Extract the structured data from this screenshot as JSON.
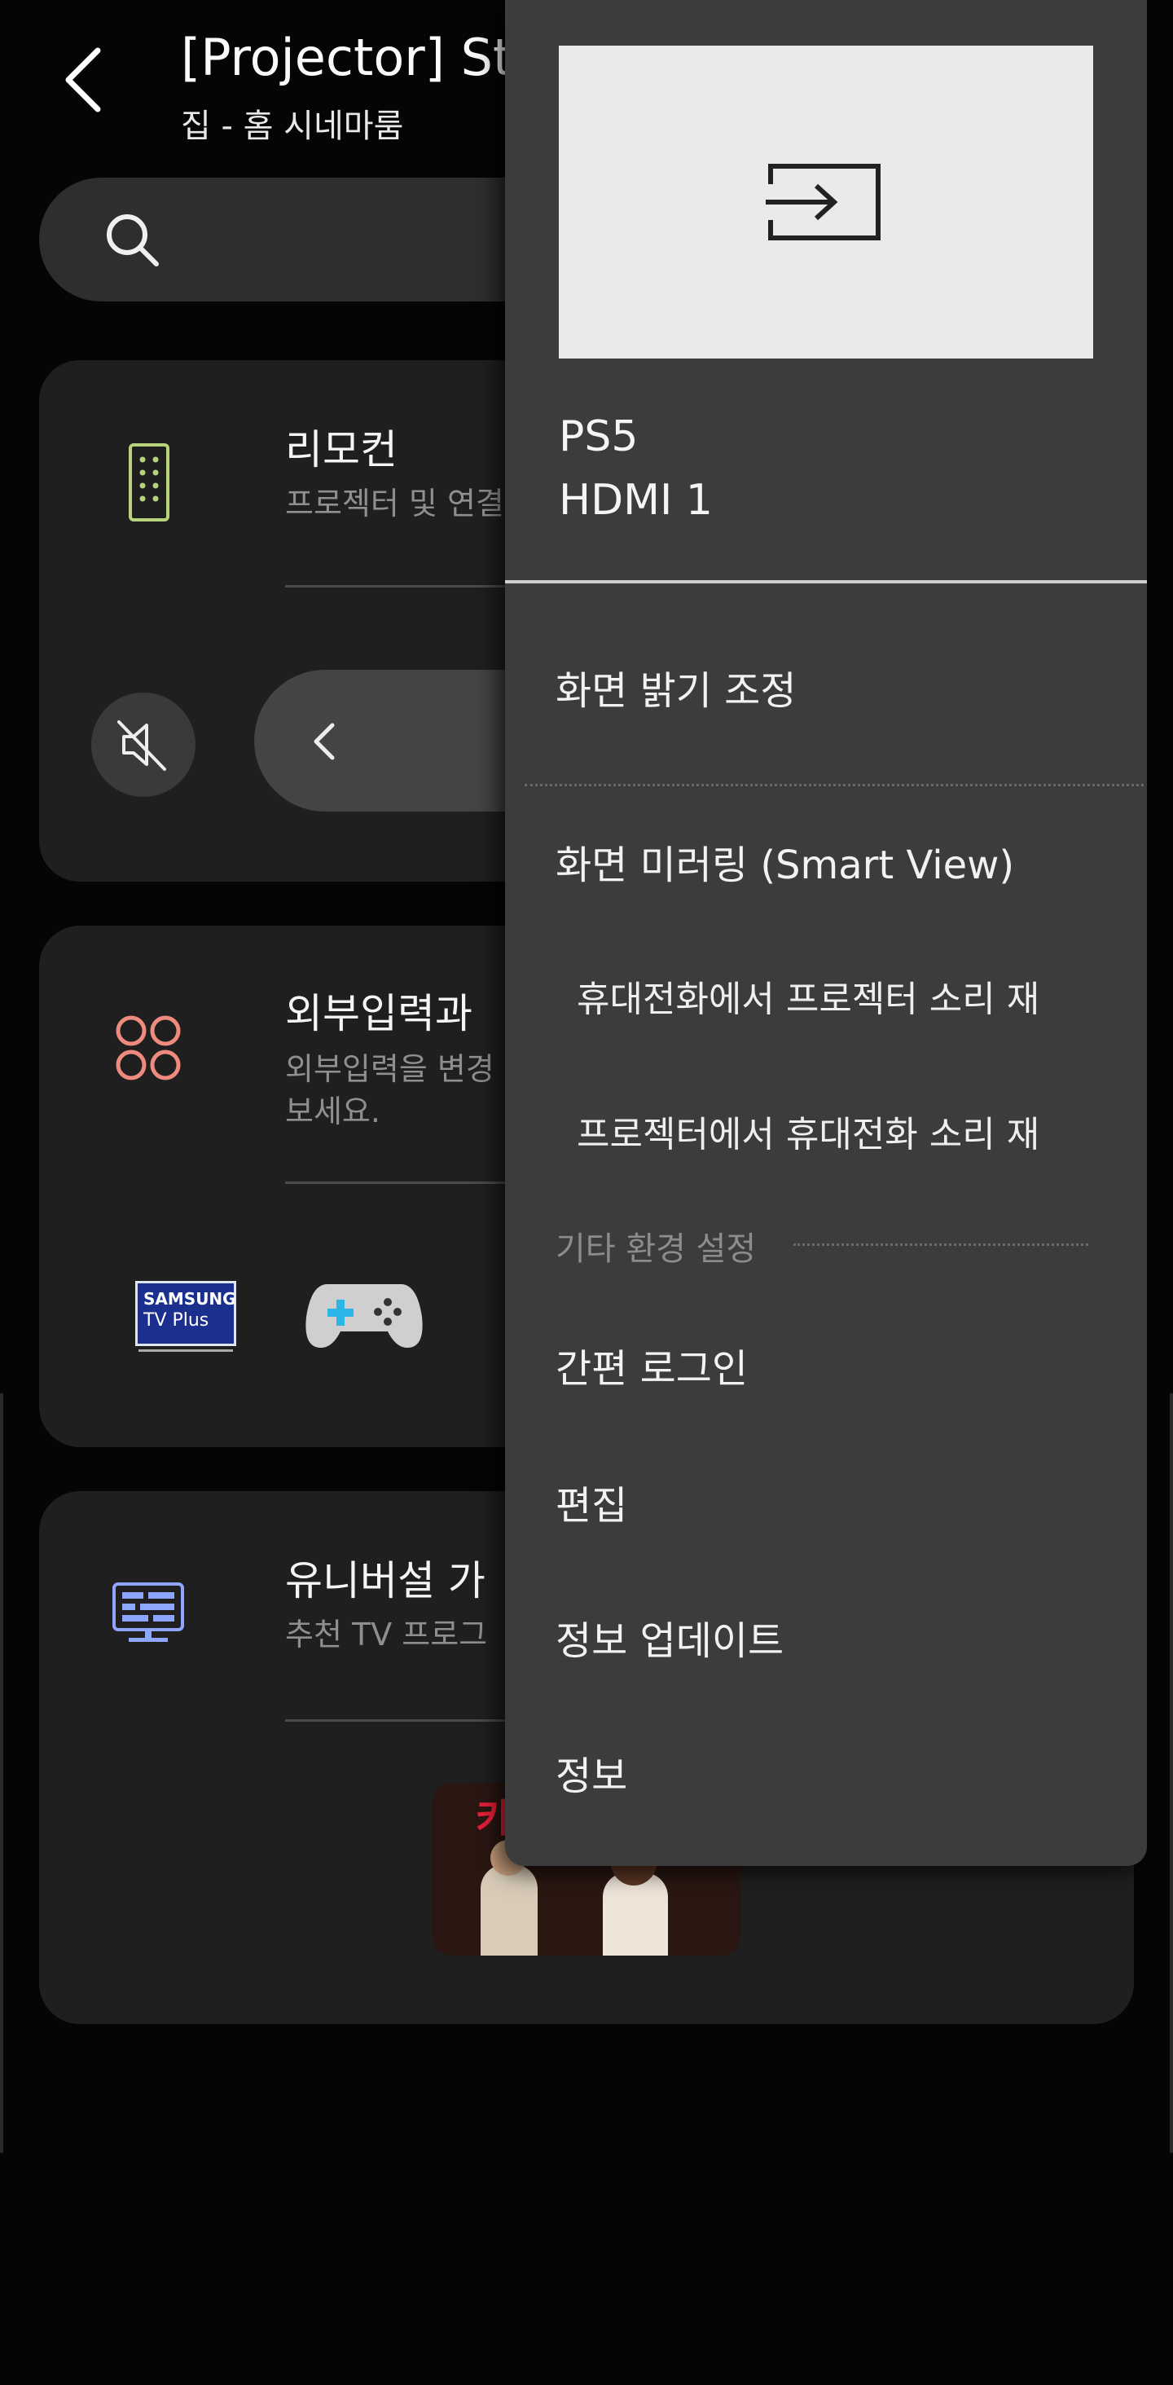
{
  "header": {
    "title": "[Projector] St",
    "subtitle": "집 - 홈 시네마룸"
  },
  "cards": {
    "remote": {
      "title": "리모컨",
      "desc": "프로젝터 및 연결"
    },
    "external_input": {
      "title": "외부입력과 ",
      "desc_line1": "외부입력을 변경",
      "desc_line2": "보세요.",
      "app1_brand": "SAMSUNG",
      "app1_name": "TV Plus"
    },
    "universal_guide": {
      "title": "유니버설 가",
      "desc": "추천 TV 프로그",
      "thumb_text": "카"
    }
  },
  "popup": {
    "device_name": "PS5",
    "device_input": "HDMI 1",
    "items": {
      "brightness": "화면 밝기 조정",
      "mirroring": "화면 미러링 (Smart View)",
      "phone_to_projector": "휴대전화에서 프로젝터 소리 재",
      "projector_to_phone": "프로젝터에서 휴대전화 소리 재",
      "section_other": "기타 환경 설정",
      "easy_login": "간편 로그인",
      "edit": "편집",
      "update_info": "정보 업데이트",
      "info": "정보"
    }
  },
  "colors": {
    "background": "#050505",
    "card": "#1f1f1f",
    "popup": "#3c3c3c",
    "remote_icon": "#b9d27c",
    "input_icon": "#ee8a7e",
    "guide_icon": "#8ea6ff"
  },
  "icons": {
    "back": "back-arrow-icon",
    "search": "search-icon",
    "remote": "remote-icon",
    "mute": "mute-icon",
    "nav": "chevron-left-icon",
    "input": "four-circles-icon",
    "game": "gamepad-icon",
    "guide": "tv-guide-icon",
    "preview": "input-source-icon"
  }
}
